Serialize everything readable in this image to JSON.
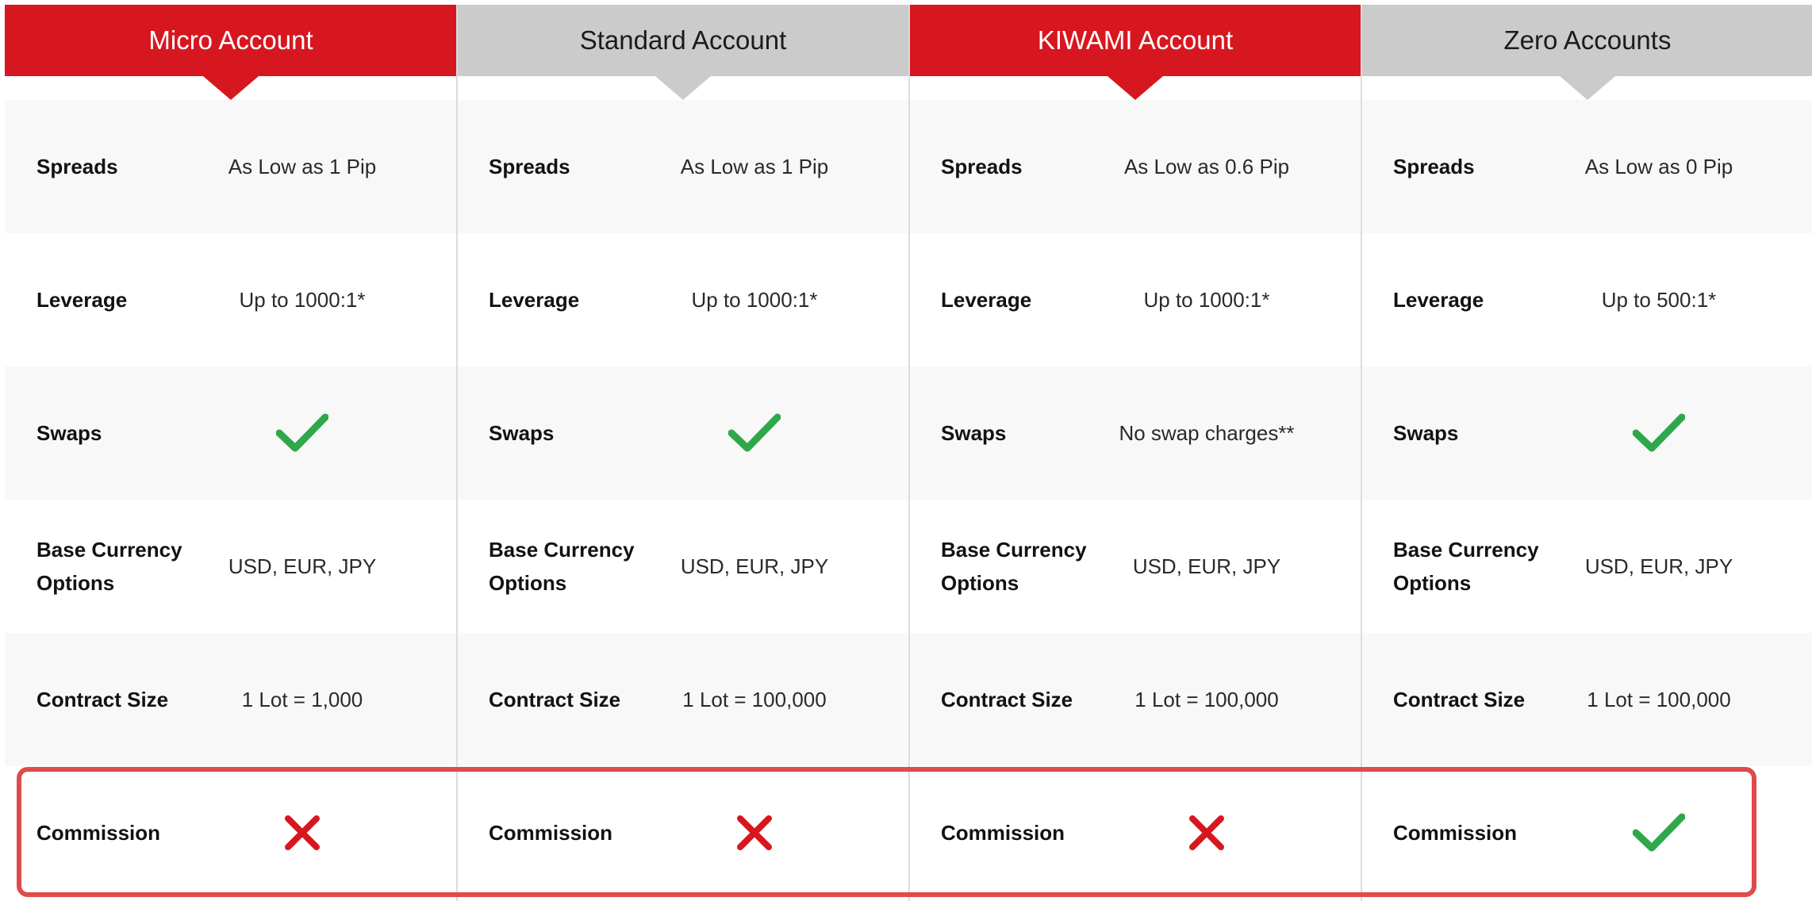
{
  "colors": {
    "accent_red": "#d7171f",
    "header_gray": "#cbcbcb",
    "check_green": "#2ea84a",
    "cross_red": "#d7171f",
    "highlight_border": "#e04a4a"
  },
  "accounts": [
    {
      "name": "Micro Account",
      "spreads": "As Low as 1 Pip",
      "leverage": "Up to 1000:1*",
      "swaps_icon": "checkmark-icon",
      "base_currency": "USD, EUR, JPY",
      "contract_size": "1 Lot = 1,000",
      "commission_icon": "cross-icon"
    },
    {
      "name": "Standard Account",
      "spreads": "As Low as 1 Pip",
      "leverage": "Up to 1000:1*",
      "swaps_icon": "checkmark-icon",
      "base_currency": "USD, EUR, JPY",
      "contract_size": "1 Lot = 100,000",
      "commission_icon": "cross-icon"
    },
    {
      "name": "KIWAMI Account",
      "spreads": "As Low as 0.6 Pip",
      "leverage": "Up to 1000:1*",
      "swaps_text": "No swap charges**",
      "base_currency": "USD, EUR, JPY",
      "contract_size": "1 Lot = 100,000",
      "commission_icon": "cross-icon"
    },
    {
      "name": "Zero Accounts",
      "spreads": "As Low as 0 Pip",
      "leverage": "Up to 500:1*",
      "swaps_icon": "checkmark-icon",
      "base_currency": "USD, EUR, JPY",
      "contract_size": "1 Lot = 100,000",
      "commission_icon": "checkmark-icon"
    }
  ],
  "features": {
    "spreads": "Spreads",
    "leverage": "Leverage",
    "swaps": "Swaps",
    "base_currency_line1": "Base Currency",
    "base_currency_line2": "Options",
    "contract_size": "Contract Size",
    "commission": "Commission"
  }
}
